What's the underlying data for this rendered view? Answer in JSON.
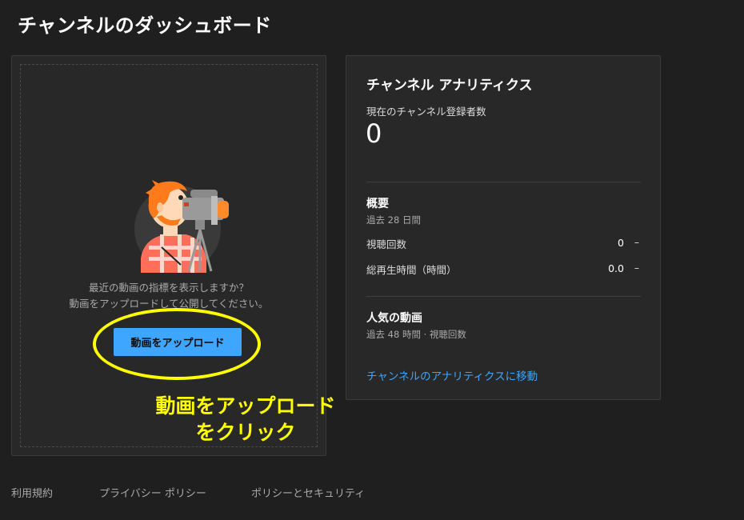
{
  "page": {
    "title": "チャンネルのダッシュボード"
  },
  "upload_card": {
    "prompt_line1": "最近の動画の指標を表示しますか？",
    "prompt_line2": "動画をアップロードして公開してください。",
    "upload_button": "動画をアップロード"
  },
  "annotation": {
    "line1": "動画をアップロード",
    "line2": "をクリック",
    "color": "#ffff00"
  },
  "analytics": {
    "title": "チャンネル アナリティクス",
    "subscribers_label": "現在のチャンネル登録者数",
    "subscribers_count": "0",
    "summary": {
      "title": "概要",
      "period": "過去 28 日間",
      "metrics": [
        {
          "label": "視聴回数",
          "value": "0",
          "trend": "–"
        },
        {
          "label": "総再生時間（時間）",
          "value": "0.0",
          "trend": "–"
        }
      ]
    },
    "popular": {
      "title": "人気の動画",
      "subtitle": "過去 48 時間 · 視聴回数"
    },
    "link": "チャンネルのアナリティクスに移動"
  },
  "footer": {
    "links": [
      "利用規約",
      "プライバシー ポリシー",
      "ポリシーとセキュリティ"
    ]
  },
  "colors": {
    "background": "#1f1f1f",
    "card": "#282828",
    "accent_blue": "#3ea6ff",
    "highlight_yellow": "#ffff00"
  }
}
